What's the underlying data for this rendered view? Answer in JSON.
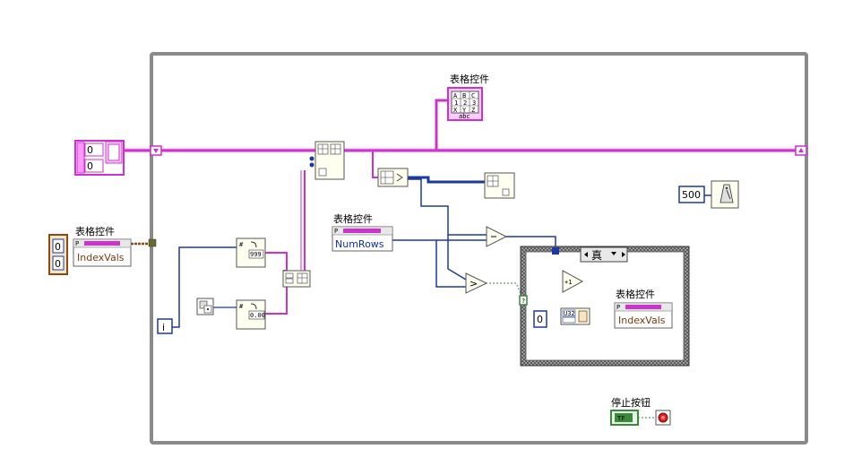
{
  "while_loop": {
    "iteration_terminal": "i"
  },
  "table_terminal": {
    "label": "表格控件",
    "icon_cells": [
      "A",
      "B",
      "C",
      "1",
      "2",
      "3",
      "X",
      "Y",
      "Z"
    ],
    "icon_footer": "abc"
  },
  "array_constant": {
    "values": [
      "0",
      "0"
    ]
  },
  "property_node_left": {
    "label": "表格控件",
    "property": "IndexVals",
    "index_values": [
      "0",
      "0"
    ]
  },
  "property_node_numrows": {
    "label": "表格控件",
    "property": "NumRows"
  },
  "property_node_case": {
    "label": "表格控件",
    "property": "IndexVals"
  },
  "case_structure": {
    "selector": "真"
  },
  "constants": {
    "wait_ms": "500",
    "index_zero": "0",
    "format_int": "999",
    "format_float": "0.00",
    "u32": "U32"
  },
  "stop_button": {
    "label": "停止按钮",
    "glyph": "TF"
  },
  "colors": {
    "wire_string": "#cc33cc",
    "wire_numeric": "#1a3aa0",
    "wire_bool": "#3a8a3a",
    "wire_cluster": "#8a4a10",
    "loop_border": "#8a8a8a"
  }
}
